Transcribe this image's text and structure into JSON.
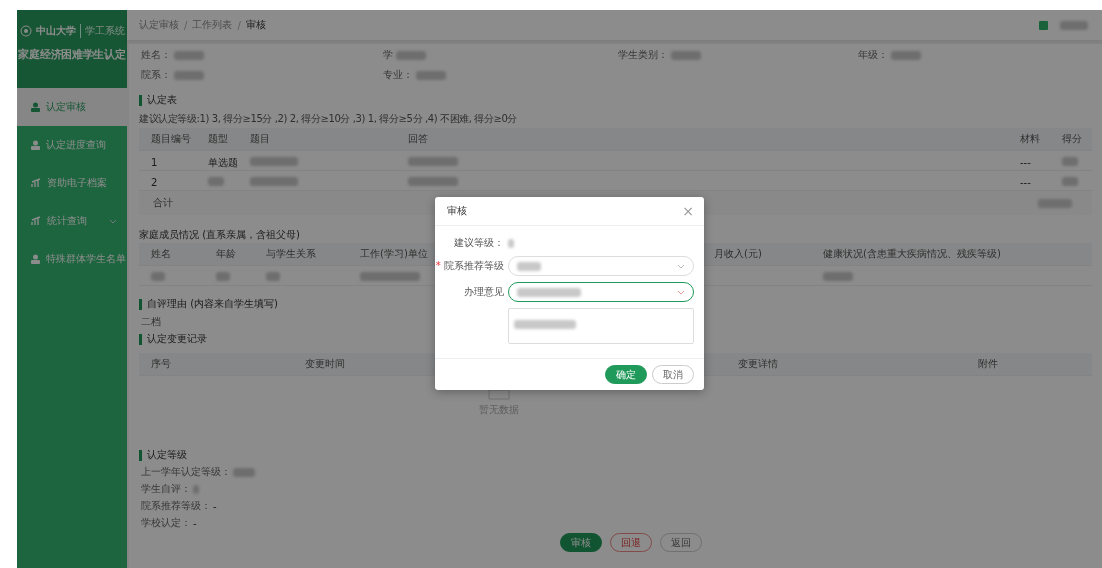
{
  "sidebar": {
    "logo_text": "中山大学",
    "logo_subtitle": "学工系统",
    "title": "家庭经济困难学生认定",
    "items": [
      {
        "label": "认定审核",
        "kind": "user",
        "selected": true,
        "expandable": false
      },
      {
        "label": "认定进度查询",
        "kind": "user",
        "selected": false,
        "expandable": false
      },
      {
        "label": "资助电子档案",
        "kind": "chart",
        "selected": false,
        "expandable": false
      },
      {
        "label": "统计查询",
        "kind": "chart",
        "selected": false,
        "expandable": true
      },
      {
        "label": "特殊群体学生名单",
        "kind": "user",
        "selected": false,
        "expandable": false
      }
    ]
  },
  "header": {
    "breadcrumb": [
      "认定审核",
      "工作列表",
      "审核"
    ],
    "separator": "/"
  },
  "student_info": [
    {
      "label": "姓名：",
      "redacted": true
    },
    {
      "label": "学",
      "redacted": true
    },
    {
      "label": "学生类别：",
      "redacted": true
    },
    {
      "label": "年级：",
      "redacted": true
    },
    {
      "label": "院系：",
      "redacted": true
    },
    {
      "label": "专业：",
      "redacted": true
    }
  ],
  "assessment": {
    "title": "认定表",
    "hint": "建议认定等级:1) 3, 得分≥15分 ,2) 2, 得分≥10分 ,3) 1, 得分≥5分 ,4) 不困难, 得分≥0分",
    "columns": [
      "题目编号",
      "题型",
      "题目",
      "回答",
      "材料",
      "得分"
    ],
    "rows": [
      [
        {
          "text": "1"
        },
        {
          "text": "单选题"
        },
        {
          "redacted": true
        },
        {
          "redacted": true
        },
        {
          "text": "---"
        },
        {
          "redacted": true
        }
      ],
      [
        {
          "text": "2"
        },
        {
          "redacted": true
        },
        {
          "redacted": true
        },
        {
          "redacted": true
        },
        {
          "text": "---"
        },
        {
          "redacted": true
        }
      ]
    ],
    "total": {
      "label": "合计",
      "redacted": true
    }
  },
  "family": {
    "title": "家庭成员情况 (直系亲属，含祖父母)",
    "columns": [
      "姓名",
      "年龄",
      "与学生关系",
      "工作(学习)单位",
      "月收入(元)",
      "健康状况(含患重大疾病情况、残疾等级)"
    ],
    "rows": [
      [
        {
          "redacted": true
        },
        {
          "redacted": true
        },
        {
          "redacted": true
        },
        {
          "redacted": true
        },
        {
          "redacted": true
        }
      ]
    ]
  },
  "self_evaluation": {
    "title": "自评理由 (内容来自学生填写)",
    "text": "二档"
  },
  "change_log": {
    "title": "认定变更记录",
    "columns": [
      "序号",
      "变更时间",
      "变更详情",
      "附件"
    ],
    "empty_text": "暂无数据"
  },
  "level": {
    "title": "认定等级",
    "previous_year": {
      "label": "上一学年认定等级：",
      "redacted": true
    },
    "student_self": {
      "label": "学生自评：",
      "redacted": true
    },
    "department": {
      "label": "院系推荐等级：",
      "value": "-"
    },
    "school": {
      "label": "学校认定：",
      "value": "-"
    }
  },
  "actions": [
    {
      "label": "审核",
      "kind": "primary"
    },
    {
      "label": "回退",
      "kind": "danger"
    },
    {
      "label": "返回",
      "kind": "default"
    }
  ],
  "dialog": {
    "title": "审核",
    "close": "×",
    "suggest_label": "建议等级：",
    "dept_label": "院系推荐等级",
    "dept_required": true,
    "required_mark": "*",
    "opinion_label": "办理意见",
    "opinion_focused": true,
    "confirm": "确定",
    "cancel": "取消"
  }
}
